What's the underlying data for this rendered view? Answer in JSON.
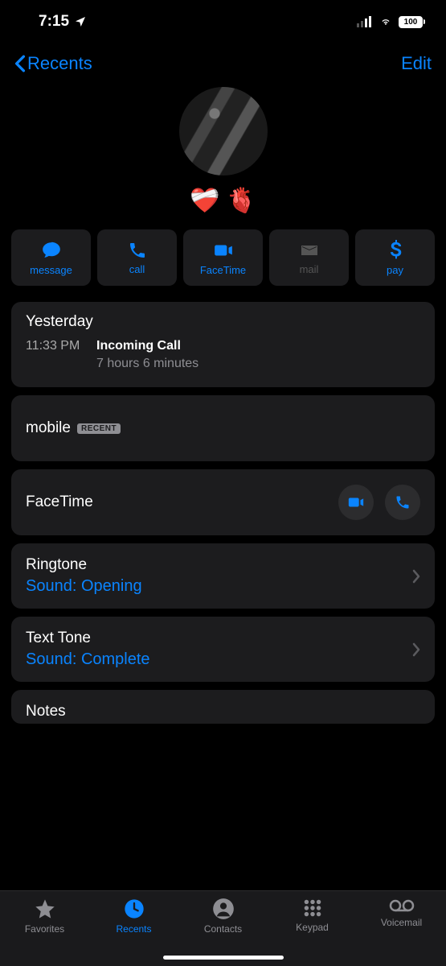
{
  "status": {
    "time": "7:15",
    "battery": "100"
  },
  "nav": {
    "back": "Recents",
    "edit": "Edit"
  },
  "contact": {
    "name_emoji1": "❤️‍🩹",
    "name_emoji2": "🫀"
  },
  "actions": {
    "message": "message",
    "call": "call",
    "facetime": "FaceTime",
    "mail": "mail",
    "pay": "pay"
  },
  "call_log": {
    "day": "Yesterday",
    "time": "11:33 PM",
    "type": "Incoming Call",
    "duration": "7 hours 6 minutes"
  },
  "mobile": {
    "label": "mobile",
    "badge": "RECENT"
  },
  "facetime": {
    "label": "FaceTime"
  },
  "ringtone": {
    "title": "Ringtone",
    "value": "Sound: Opening"
  },
  "texttone": {
    "title": "Text Tone",
    "value": "Sound: Complete"
  },
  "notes": {
    "title": "Notes"
  },
  "tabs": {
    "favorites": "Favorites",
    "recents": "Recents",
    "contacts": "Contacts",
    "keypad": "Keypad",
    "voicemail": "Voicemail"
  }
}
